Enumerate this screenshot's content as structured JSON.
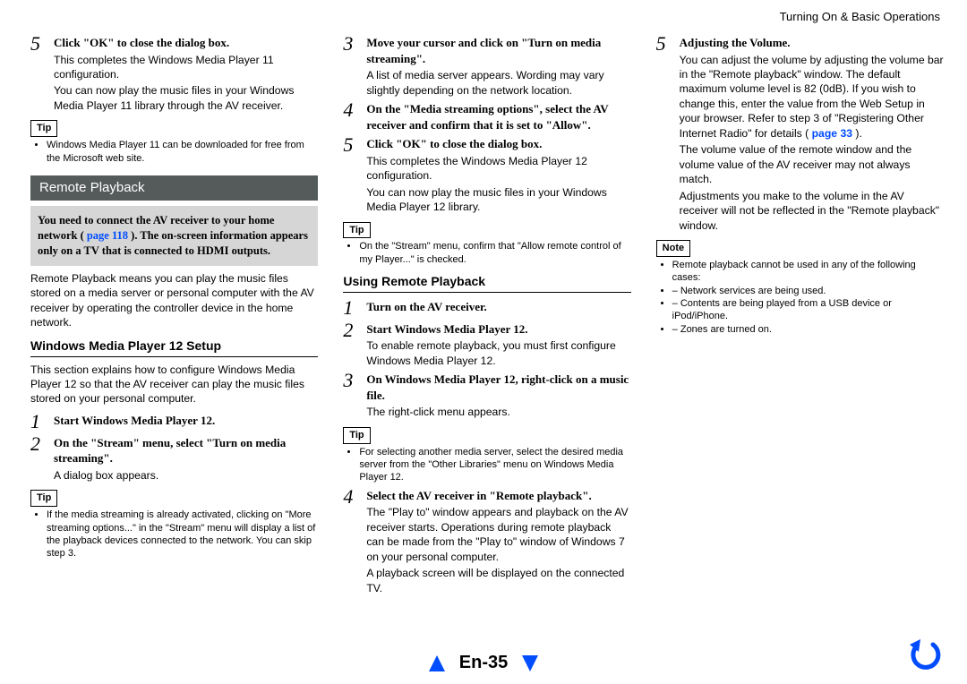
{
  "header": {
    "section": "Turning On & Basic Operations"
  },
  "col1": {
    "step5": {
      "num": "5",
      "title": "Click \"OK\" to close the dialog box.",
      "desc1": "This completes the Windows Media Player 11 configuration.",
      "desc2": "You can now play the music files in your Windows Media Player 11 library through the AV receiver."
    },
    "tip_label": "Tip",
    "tip1": "Windows Media Player 11 can be downloaded for free from the Microsoft web site.",
    "section_band": "Remote Playback",
    "highlight_pre": "You need to connect the AV receiver to your home network (",
    "highlight_link": "page 118",
    "highlight_post": "). The on-screen information appears only on a TV that is connected to HDMI outputs.",
    "remote_para": "Remote Playback means you can play the music files stored on a media server or personal computer with the AV receiver by operating the controller device in the home network.",
    "subhead": "Windows Media Player 12 Setup",
    "setup_para": "This section explains how to configure Windows Media Player 12 so that the AV receiver can play the music files stored on your personal computer.",
    "step1": {
      "num": "1",
      "title": "Start Windows Media Player 12."
    },
    "step2": {
      "num": "2",
      "title": "On the \"Stream\" menu, select \"Turn on media streaming\".",
      "desc": "A dialog box appears."
    },
    "tip2_label": "Tip",
    "tip2": "If the media streaming is already activated, clicking on \"More streaming options...\" in the \"Stream\" menu will display a list of the playback devices connected to the network. You can skip step 3."
  },
  "col2": {
    "step3": {
      "num": "3",
      "title": "Move your cursor and click on \"Turn on media streaming\".",
      "desc": "A list of media server appears. Wording may vary slightly depending on the network location."
    },
    "step4": {
      "num": "4",
      "title": "On the \"Media streaming options\", select the AV receiver and confirm that it is set to \"Allow\"."
    },
    "step5": {
      "num": "5",
      "title": "Click \"OK\" to close the dialog box.",
      "desc1": "This completes the Windows Media Player 12 configuration.",
      "desc2": "You can now play the music files in your Windows Media Player 12 library."
    },
    "tip_label": "Tip",
    "tip1": "On the \"Stream\" menu, confirm that \"Allow remote control of my Player...\" is checked.",
    "subhead": "Using Remote Playback",
    "u1": {
      "num": "1",
      "title": "Turn on the AV receiver."
    },
    "u2": {
      "num": "2",
      "title": "Start Windows Media Player 12.",
      "desc": "To enable remote playback, you must first configure Windows Media Player 12."
    },
    "u3": {
      "num": "3",
      "title": "On Windows Media Player 12, right-click on a music file.",
      "desc": "The right-click menu appears."
    },
    "tip2_label": "Tip",
    "tip2": "For selecting another media server, select the desired media server from the \"Other Libraries\" menu on Windows Media Player 12.",
    "u4": {
      "num": "4",
      "title": "Select the AV receiver in \"Remote playback\".",
      "desc1": "The \"Play to\" window appears and playback on the AV receiver starts. Operations during remote playback can be made from the \"Play to\" window of Windows 7 on your personal computer.",
      "desc2": "A playback screen will be displayed on the connected TV."
    }
  },
  "col3": {
    "step5": {
      "num": "5",
      "title": "Adjusting the Volume.",
      "p1_pre": "You can adjust the volume by adjusting the volume bar in the \"Remote playback\" window. The default maximum volume level is 82 (0dB). If you wish to change this, enter the value from the Web Setup in your browser. Refer to step 3 of \"Registering Other Internet Radio\" for details (",
      "p1_link": "page 33",
      "p1_post": ").",
      "p2": "The volume value of the remote window and the volume value of the AV receiver may not always match.",
      "p3": "Adjustments you make to the volume in the AV receiver will not be reflected in the \"Remote playback\" window."
    },
    "note_label": "Note",
    "note1": "Remote playback cannot be used in any of the following cases:",
    "note_sub1": "Network services are being used.",
    "note_sub2": "Contents are being played from a USB device or iPod/iPhone.",
    "note_sub3": "Zones are turned on."
  },
  "footer": {
    "page": "En-35"
  }
}
